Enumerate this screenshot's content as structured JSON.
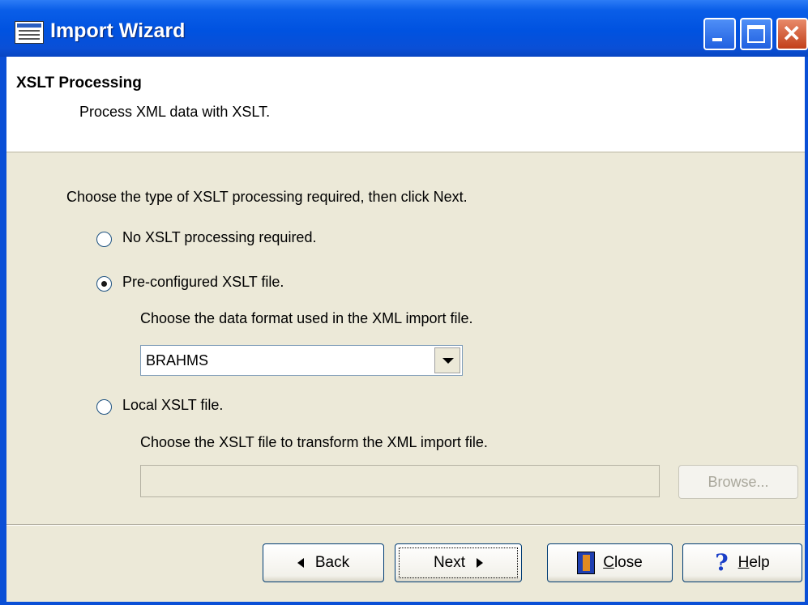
{
  "window": {
    "title": "Import Wizard"
  },
  "header": {
    "title": "XSLT Processing",
    "subtitle": "Process XML data with XSLT."
  },
  "main": {
    "instruction": "Choose the type of XSLT processing required, then click Next.",
    "options": [
      {
        "label": "No XSLT processing required.",
        "checked": false
      },
      {
        "label": "Pre-configured XSLT file.",
        "checked": true
      },
      {
        "label": "Local XSLT file.",
        "checked": false
      }
    ],
    "preconfigured_hint": "Choose the data format used in the XML import file.",
    "format_select_value": "BRAHMS",
    "local_hint": "Choose the XSLT file to transform the XML import file.",
    "local_file_value": "",
    "browse_label": "Browse..."
  },
  "footer": {
    "back_label": "Back",
    "next_label": "Next",
    "close_mnemonic": "C",
    "close_rest": "lose",
    "help_mnemonic": "H",
    "help_rest": "elp"
  },
  "icons": {
    "app": "import-wizard-icon",
    "close_button_icon": "door-exit-icon",
    "help_button_icon": "question-mark-icon"
  },
  "colors": {
    "titlebar": "#0a4fd6",
    "dialog_background": "#ece9d8",
    "header_background": "#ffffff"
  }
}
